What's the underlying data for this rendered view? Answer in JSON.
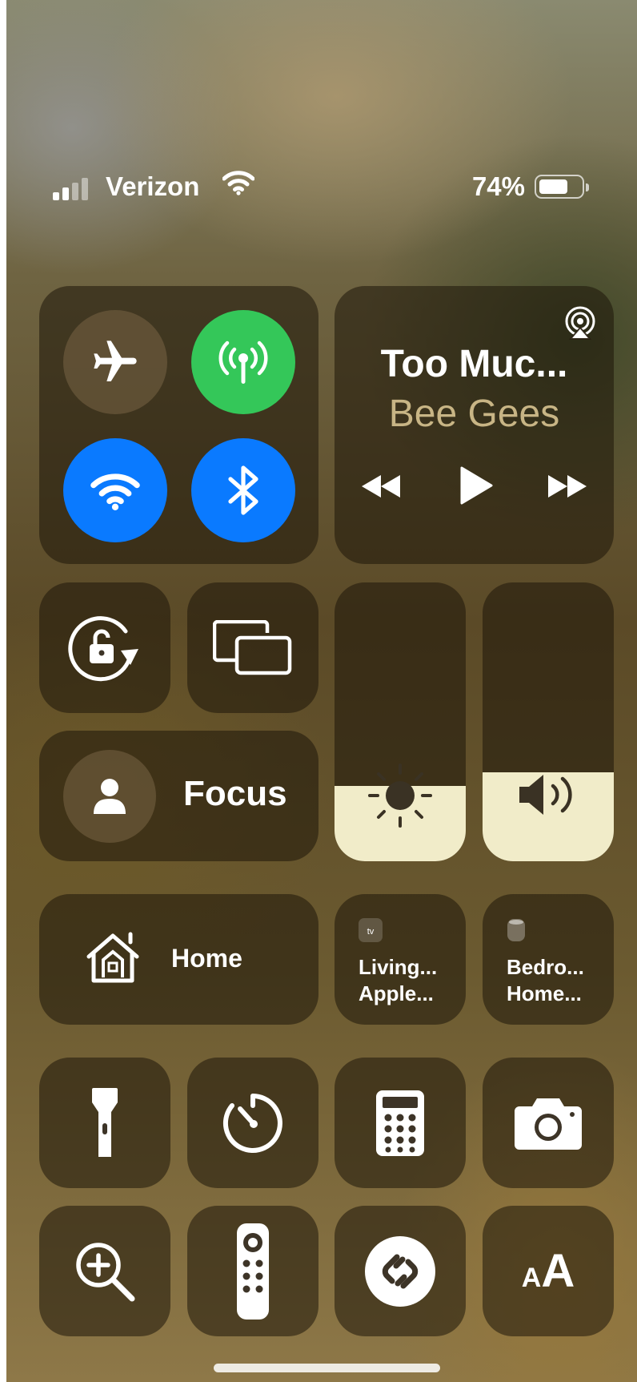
{
  "status_bar": {
    "carrier": "Verizon",
    "battery_percent": "74%",
    "battery_level": 0.74,
    "signal_bars_filled": 2,
    "signal_bars_total": 4
  },
  "connectivity": {
    "airplane": {
      "icon": "airplane-icon",
      "on": false
    },
    "cellular": {
      "icon": "antenna-icon",
      "on": true,
      "color": "#34c759"
    },
    "wifi": {
      "icon": "wifi-icon",
      "on": true,
      "color": "#0a7aff"
    },
    "bluetooth": {
      "icon": "bluetooth-icon",
      "on": true,
      "color": "#0a7aff"
    }
  },
  "now_playing": {
    "title": "Too Muc...",
    "artist": "Bee Gees",
    "artist_color": "#c8b585"
  },
  "focus": {
    "label": "Focus"
  },
  "brightness": {
    "level": 0.27
  },
  "volume": {
    "level": 0.32
  },
  "home": {
    "label": "Home"
  },
  "accessories": [
    {
      "line1": "Living...",
      "line2": "Apple...",
      "badge": "tv"
    },
    {
      "line1": "Bedro...",
      "line2": "Home..."
    }
  ],
  "controls": [
    "flashlight",
    "timer",
    "calculator",
    "camera",
    "magnifier",
    "apple-tv-remote",
    "shazam",
    "text-size"
  ],
  "text_size_glyphs": {
    "small": "A",
    "large": "A"
  }
}
